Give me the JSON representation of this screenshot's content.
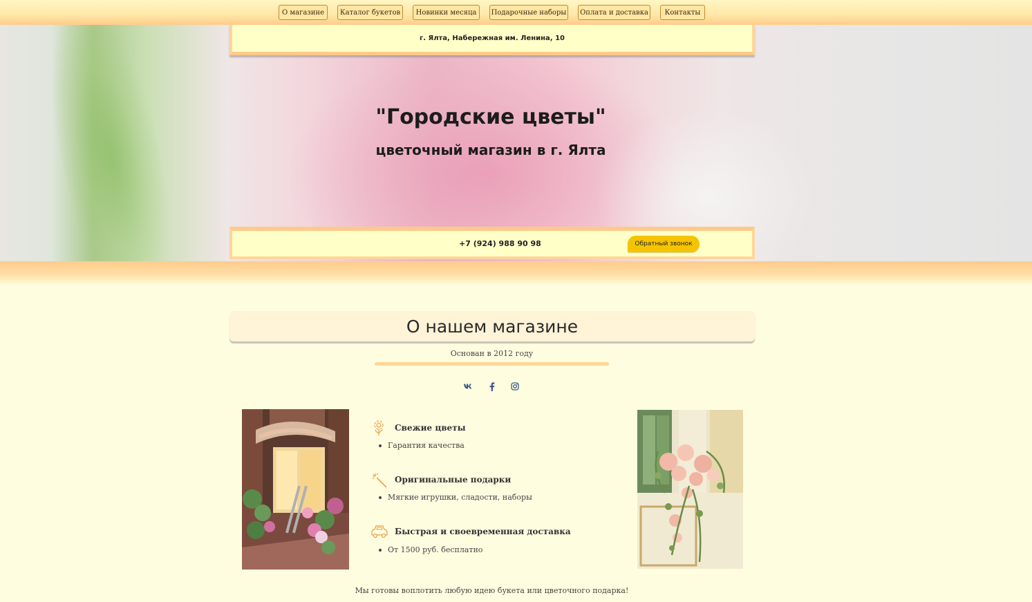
{
  "nav": {
    "items": [
      {
        "label": "О магазине"
      },
      {
        "label": "Каталог букетов"
      },
      {
        "label": "Новинки месяца"
      },
      {
        "label": "Подарочные наборы"
      },
      {
        "label": "Оплата и доставка"
      },
      {
        "label": "Контакты"
      }
    ]
  },
  "hero": {
    "address": "г. Ялта, Набережная им. Ленина, 10",
    "title": "\"Городские цветы\"",
    "subtitle": "цветочный магазин в г. Ялта",
    "phone": "+7 (924) 988 90 98",
    "callback_label": "Обратный звонок"
  },
  "about": {
    "heading": "О нашем магазине",
    "founded": "Основан в 2012 году",
    "social": [
      {
        "icon": "vk-icon"
      },
      {
        "icon": "facebook-icon"
      },
      {
        "icon": "instagram-icon"
      }
    ],
    "features": [
      {
        "icon": "flower-icon",
        "title": "Свежие цветы",
        "item": "Гарантия качества"
      },
      {
        "icon": "magic-wand-icon",
        "title": "Оригинальные подарки",
        "item": "Мягкие игрушки, сладости, наборы"
      },
      {
        "icon": "car-icon",
        "title": "Быстрая и своевременная доставка",
        "item": "От 1500 руб. бесплатно"
      }
    ],
    "footer_text": "Мы готовы воплотить любую идею букета или цветочного подарка!"
  },
  "colors": {
    "background": "#fffde0",
    "accent": "#ffc98a",
    "button_yellow": "#f5c400",
    "icon_orange": "#e8a24a",
    "social_blue": "#3b5a8a"
  }
}
